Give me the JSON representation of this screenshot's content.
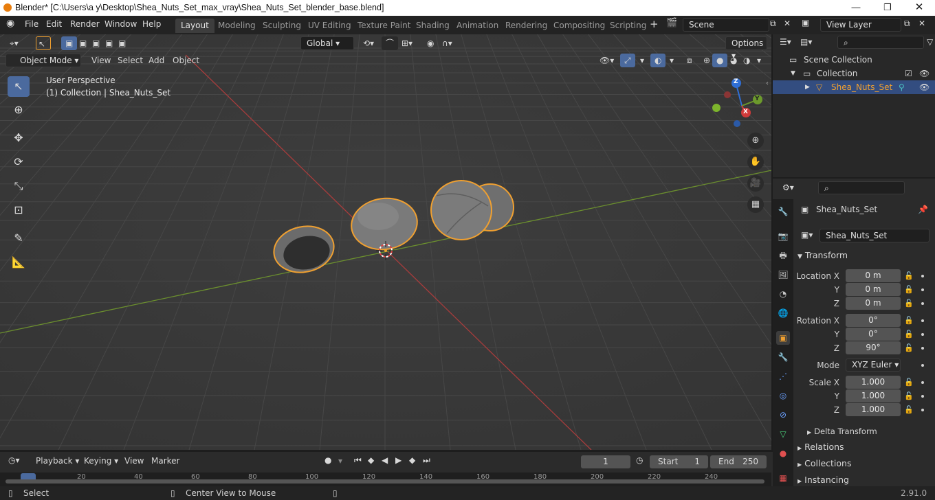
{
  "window": {
    "title": "Blender* [C:\\Users\\a y\\Desktop\\Shea_Nuts_Set_max_vray\\Shea_Nuts_Set_blender_base.blend]"
  },
  "menu": [
    "File",
    "Edit",
    "Render",
    "Window",
    "Help"
  ],
  "workspaces": [
    "Layout",
    "Modeling",
    "Sculpting",
    "UV Editing",
    "Texture Paint",
    "Shading",
    "Animation",
    "Rendering",
    "Compositing",
    "Scripting"
  ],
  "scene": {
    "name": "Scene",
    "view_layer": "View Layer"
  },
  "tool_header": {
    "orientation": "Global",
    "options": "Options"
  },
  "viewport_header": {
    "mode": "Object Mode",
    "menus": [
      "View",
      "Select",
      "Add",
      "Object"
    ]
  },
  "viewport": {
    "perspective": "User Perspective",
    "collection_info": "(1) Collection | Shea_Nuts_Set"
  },
  "gizmo": {
    "x": "X",
    "y": "Y",
    "z": "Z"
  },
  "outliner": {
    "scene_collection": "Scene Collection",
    "collection": "Collection",
    "object": "Shea_Nuts_Set"
  },
  "properties": {
    "object_name": "Shea_Nuts_Set",
    "data_name": "Shea_Nuts_Set",
    "transform_label": "Transform",
    "location_label": "Location X",
    "rotation_label": "Rotation X",
    "scale_label": "Scale X",
    "y_label": "Y",
    "z_label": "Z",
    "location": [
      "0 m",
      "0 m",
      "0 m"
    ],
    "rotation": [
      "0°",
      "0°",
      "90°"
    ],
    "mode_label": "Mode",
    "mode_value": "XYZ Euler",
    "scale": [
      "1.000",
      "1.000",
      "1.000"
    ],
    "delta_transform": "Delta Transform",
    "relations": "Relations",
    "collections": "Collections",
    "instancing": "Instancing"
  },
  "timeline": {
    "menus": [
      "Playback",
      "Keying",
      "View",
      "Marker"
    ],
    "current_frame": "1",
    "start_label": "Start",
    "start_value": "1",
    "end_label": "End",
    "end_value": "250",
    "ruler": [
      "20",
      "40",
      "60",
      "80",
      "100",
      "120",
      "140",
      "160",
      "180",
      "200",
      "220",
      "240"
    ]
  },
  "statusbar": {
    "left": "Select",
    "middle": "Center View to Mouse",
    "version": "2.91.0"
  },
  "colors": {
    "accent": "#4b6a9e",
    "selection": "#f0a030",
    "axis_x": "#a83c3c",
    "axis_y": "#6b8f2e"
  }
}
